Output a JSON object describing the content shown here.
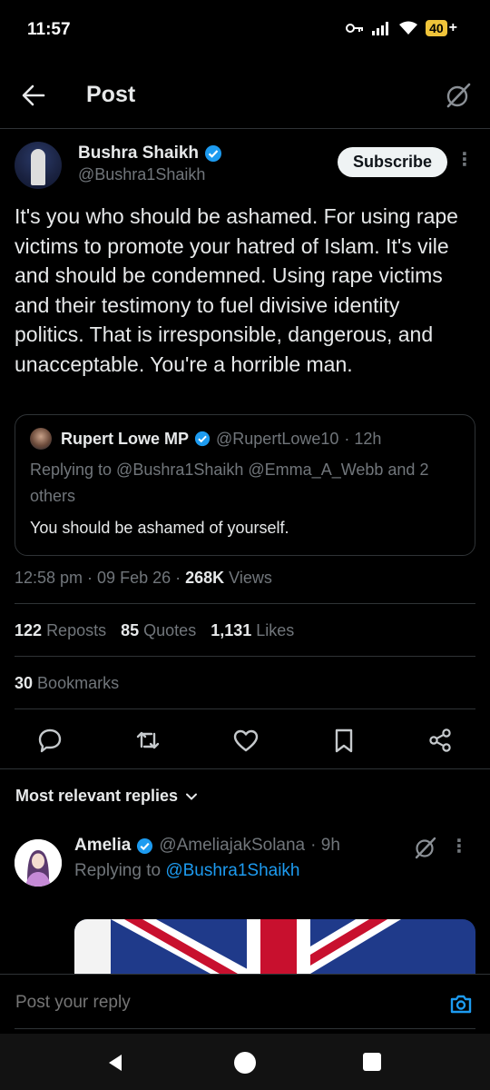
{
  "status_bar": {
    "time": "11:57",
    "battery": "40",
    "battery_suffix": "+"
  },
  "header": {
    "title": "Post"
  },
  "post": {
    "author_name": "Bushra Shaikh",
    "author_handle": "@Bushra1Shaikh",
    "subscribe_label": "Subscribe",
    "text": "It's you who should be ashamed. For using rape victims to promote your hatred of Islam. It's vile and should be condemned. Using rape victims and their testimony to fuel divisive identity politics. That is irresponsible, dangerous, and unacceptable. You're a horrible man.",
    "quote": {
      "author_name": "Rupert Lowe MP",
      "author_handle": "@RupertLowe10",
      "time": "· 12h",
      "replying_to": "Replying to @Bushra1Shaikh @Emma_A_Webb and 2 others",
      "text": "You should be ashamed of yourself."
    },
    "meta": {
      "time": "12:58 pm · 09 Feb 26 · ",
      "views_count": "268K",
      "views_label": " Views"
    },
    "stats": {
      "reposts_count": "122",
      "reposts_label": "Reposts",
      "quotes_count": "85",
      "quotes_label": "Quotes",
      "likes_count": "1,131",
      "likes_label": "Likes",
      "bookmarks_count": "30",
      "bookmarks_label": "Bookmarks"
    }
  },
  "replies": {
    "sort_label": "Most relevant replies",
    "items": [
      {
        "author_name": "Amelia",
        "author_handle": "@AmeliajakSolana",
        "time": "· 9h",
        "replying_prefix": "Replying to ",
        "replying_mention": "@Bushra1Shaikh"
      }
    ]
  },
  "compose": {
    "placeholder": "Post your reply"
  },
  "colors": {
    "accent": "#1d9bf0",
    "verified": "#1d9bf0",
    "muted": "#71767b",
    "text": "#e7e9ea",
    "border": "#2f3336"
  }
}
